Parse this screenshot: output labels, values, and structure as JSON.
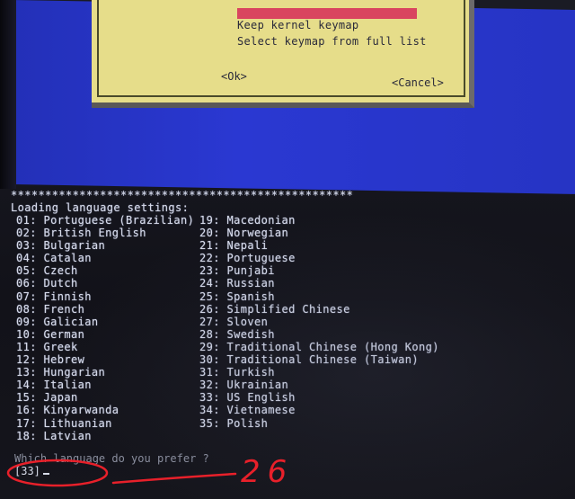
{
  "dialog": {
    "selected_item": "Keep kernel keymap",
    "items": [
      "Keep kernel keymap",
      "Select keymap from full list"
    ],
    "ok_label": "<Ok>",
    "cancel_label": "<Cancel>"
  },
  "console": {
    "separator": "*****************************************************",
    "heading": "Loading language settings:",
    "languages_left": [
      "01: Portuguese (Brazilian)",
      "02: British English",
      "03: Bulgarian",
      "04: Catalan",
      "05: Czech",
      "06: Dutch",
      "07: Finnish",
      "08: French",
      "09: Galician",
      "10: German",
      "11: Greek",
      "12: Hebrew",
      "13: Hungarian",
      "14: Italian",
      "15: Japan",
      "16: Kinyarwanda",
      "17: Lithuanian",
      "18: Latvian"
    ],
    "languages_right": [
      "19: Macedonian",
      "20: Norwegian",
      "21: Nepali",
      "22: Portuguese",
      "23: Punjabi",
      "24: Russian",
      "25: Spanish",
      "26: Simplified Chinese",
      "27: Sloven",
      "28: Swedish",
      "29: Traditional Chinese (Hong Kong)",
      "30: Traditional Chinese (Taiwan)",
      "31: Turkish",
      "32: Ukrainian",
      "33: US English",
      "34: Vietnamese",
      "35: Polish"
    ],
    "prompt": "Which language do you prefer ?",
    "default_answer": "[33]"
  },
  "annotation": {
    "handwritten_text": "26",
    "ink_color": "#e8202a"
  }
}
